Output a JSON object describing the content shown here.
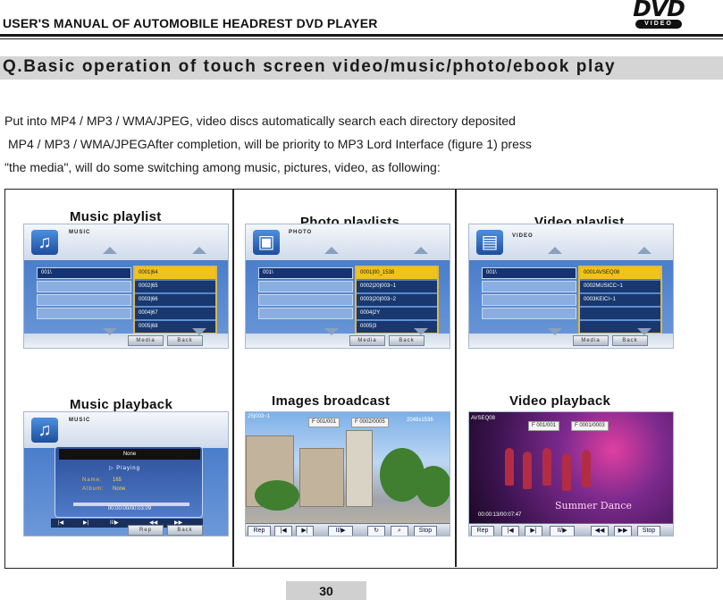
{
  "header": {
    "title": "USER'S MANUAL OF AUTOMOBILE HEADREST DVD PLAYER",
    "logo_text": "DVD",
    "logo_sub": "VIDEO"
  },
  "section": {
    "title": "Q.Basic operation of touch screen video/music/photo/ebook play"
  },
  "intro": {
    "line1": "Put into MP4 / MP3 / WMA/JPEG, video discs automatically search each directory deposited",
    "line2": "MP4 / MP3 / WMA/JPEGAfter completion, will be priority to MP3 Lord Interface (figure 1) press",
    "line3": "\"the media\", will do some switching among music, pictures, video, as following:"
  },
  "panels": {
    "music_playlist": {
      "title": "Music playlist",
      "sub": "MUSIC",
      "folder": "001\\",
      "files": [
        "0001|64",
        "0002|65",
        "0003|66",
        "0004|67",
        "0005|68"
      ],
      "btn_media": "Media",
      "btn_back": "Back"
    },
    "photo_playlist": {
      "title": "Photo playlists",
      "sub": "PHOTO",
      "folder": "001\\",
      "files": [
        "0001|00_1538",
        "0002|20|003~1",
        "0003|20|003~2",
        "0004|2Y",
        "0005|3"
      ],
      "btn_media": "Media",
      "btn_back": "Back"
    },
    "video_playlist": {
      "title": "Video playlist",
      "sub": "VIDEO",
      "folder": "001\\",
      "files": [
        "0001AVSEQ08",
        "0002MUSICC~1",
        "0003KEICI~1"
      ],
      "btn_media": "Media",
      "btn_back": "Back"
    },
    "music_playback": {
      "title": "Music playback",
      "sub": "MUSIC",
      "name_bar": "None",
      "status": "Playing",
      "name_label": "Name:",
      "name_value": "165",
      "album_label": "Album:",
      "album_value": "None",
      "time": "00:00:00/00:03:09",
      "progress": 0.0,
      "btn_rep": "Rep",
      "btn_back": "Back"
    },
    "images_broadcast": {
      "title": "Images broadcast",
      "file": "25|003~1",
      "count_a": "F 001/001",
      "count_b": "F 0002/0005",
      "resolution": "2048x1536",
      "tb_rep": "Rep",
      "tb_stop": "Stop"
    },
    "video_playback": {
      "title": "Video playback",
      "file": "AVSEQ08",
      "count_a": "F 001/001",
      "count_b": "F 0001/0003",
      "time": "00:00:13/00:07:47",
      "caption": "Summer Dance",
      "tb_rep": "Rep",
      "tb_stop": "Stop"
    }
  },
  "page_number": "30"
}
